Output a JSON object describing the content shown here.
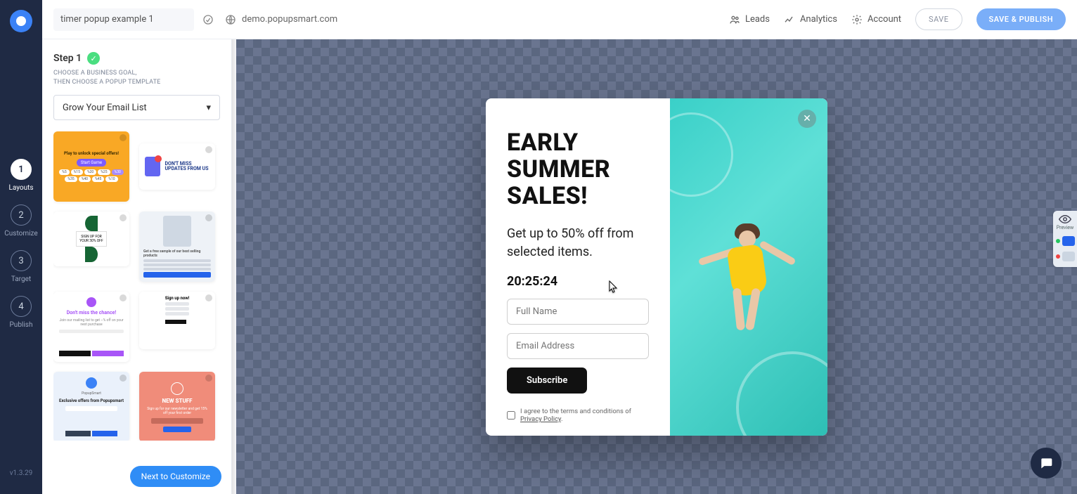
{
  "app": {
    "version": "v1.3.29"
  },
  "topbar": {
    "campaign_name": "timer popup example 1",
    "domain": "demo.popupsmart.com",
    "links": {
      "leads": "Leads",
      "analytics": "Analytics",
      "account": "Account"
    },
    "buttons": {
      "save": "SAVE",
      "publish": "SAVE & PUBLISH"
    }
  },
  "rail": {
    "steps": [
      {
        "num": "1",
        "label": "Layouts"
      },
      {
        "num": "2",
        "label": "Customize"
      },
      {
        "num": "3",
        "label": "Target"
      },
      {
        "num": "4",
        "label": "Publish"
      }
    ]
  },
  "panel": {
    "step_title": "Step 1",
    "subtitle_line1": "CHOOSE A BUSINESS GOAL,",
    "subtitle_line2": "THEN CHOOSE A POPUP TEMPLATE",
    "goal_selected": "Grow Your Email List",
    "next_button": "Next to Customize",
    "templates": {
      "t1_head": "Play to unlock special offers!",
      "t1_start": "Start Game",
      "t2_txt": "DON'T MISS UPDATES FROM US",
      "t3_txt": "SIGN UP FOR YOUR 30% OFF",
      "t4_txt": "Get a free sample of our best selling products",
      "t5_head": "Don't miss the chance!",
      "t6_head": "Sign up now!",
      "t7_head": "Exclusive offers from Popupsmart",
      "t8_head": "NEW STUFF"
    }
  },
  "popup": {
    "title": "EARLY SUMMER SALES!",
    "desc": "Get up to 50% off from selected items.",
    "timer": "20:25:24",
    "placeholder_name": "Full Name",
    "placeholder_email": "Email Address",
    "subscribe": "Subscribe",
    "agree_pre": "I agree to the terms and conditions of ",
    "agree_link": "Privacy Policy"
  },
  "preview_widget": {
    "label": "Preview"
  }
}
